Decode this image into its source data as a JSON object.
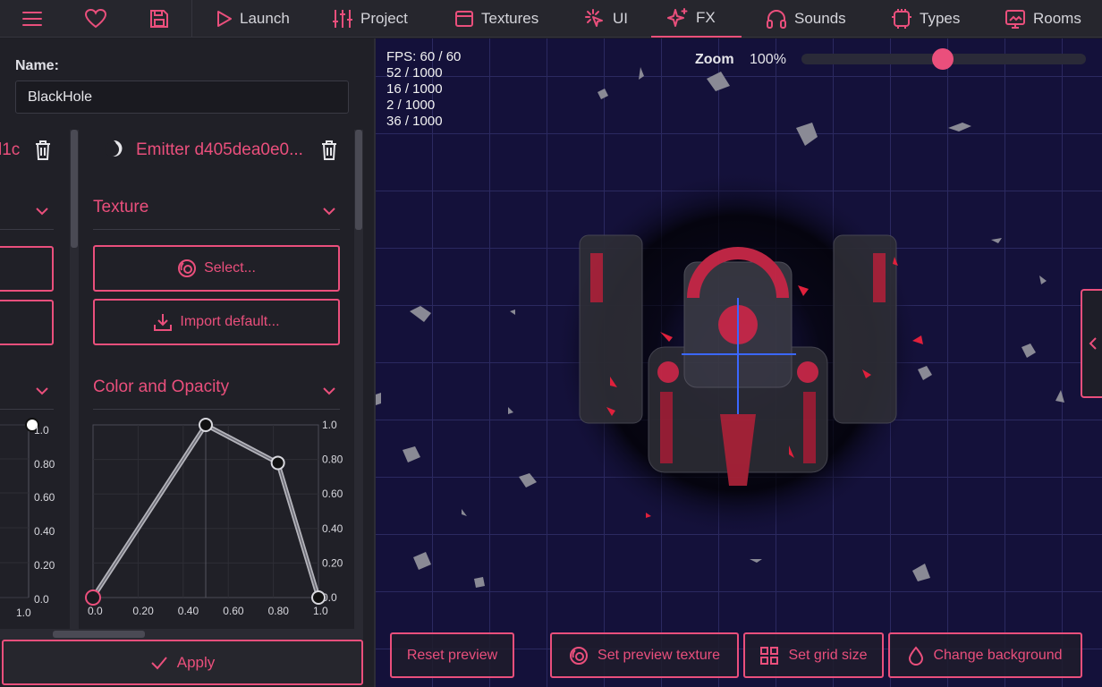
{
  "nav": {
    "tabs": [
      {
        "label": "Launch",
        "icon": "play-icon"
      },
      {
        "label": "Project",
        "icon": "sliders-icon"
      },
      {
        "label": "Textures",
        "icon": "texture-icon"
      },
      {
        "label": "UI",
        "icon": "cursor-click-icon"
      },
      {
        "label": "FX",
        "icon": "sparkle-icon"
      },
      {
        "label": "Sounds",
        "icon": "headphones-icon"
      },
      {
        "label": "Types",
        "icon": "types-icon"
      },
      {
        "label": "Rooms",
        "icon": "rooms-icon"
      }
    ],
    "active": "FX"
  },
  "editor": {
    "name_label": "Name:",
    "name_value": "BlackHole",
    "col1_title": "l1c",
    "emitter_title": "Emitter d405dea0e0...",
    "texture_section": "Texture",
    "select_button": "Select...",
    "import_button": "Import default...",
    "color_section": "Color and Opacity",
    "graph_y_ticks": [
      "1.0",
      "0.80",
      "0.60",
      "0.40",
      "0.20",
      "0.0"
    ],
    "graph_x_ticks": [
      "0.0",
      "0.20",
      "0.40",
      "0.60",
      "0.80",
      "1.0"
    ],
    "col1_x_tick": "1.0",
    "apply_button": "Apply",
    "opacity_curve": [
      [
        0.0,
        0.0
      ],
      [
        0.5,
        1.0
      ],
      [
        0.82,
        0.78
      ],
      [
        1.0,
        0.0
      ]
    ]
  },
  "viewport": {
    "fps": "FPS: 60 / 60",
    "counters": [
      "52 / 1000",
      "16 / 1000",
      "2 / 1000",
      "36 / 1000"
    ],
    "zoom_label": "Zoom",
    "zoom_value": "100%",
    "zoom_level": 0.5,
    "buttons": {
      "reset": "Reset preview",
      "set_texture": "Set preview texture",
      "grid": "Set grid size",
      "background": "Change background"
    }
  },
  "colors": {
    "accent": "#ea4f7c",
    "viewport_bg": "#14113a",
    "panel_bg": "#202027"
  }
}
